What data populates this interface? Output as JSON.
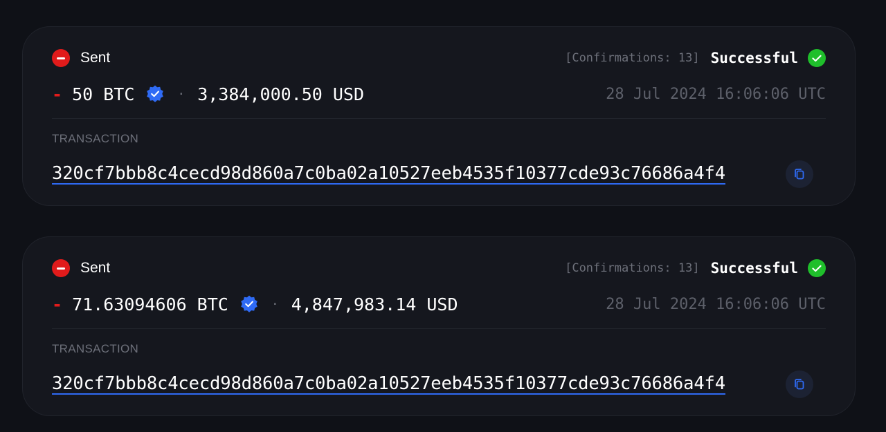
{
  "transactions": [
    {
      "direction": "Sent",
      "confirmations": "[Confirmations: 13]",
      "status": "Successful",
      "sign": "-",
      "amount": "50 BTC",
      "fiat": "3,384,000.50 USD",
      "separator": "·",
      "timestamp": "28 Jul 2024 16:06:06 UTC",
      "section_label": "TRANSACTION",
      "hash": "320cf7bbb8c4cecd98d860a7c0ba02a10527eeb4535f10377cde93c76686a4f4"
    },
    {
      "direction": "Sent",
      "confirmations": "[Confirmations: 13]",
      "status": "Successful",
      "sign": "-",
      "amount": "71.63094606 BTC",
      "fiat": "4,847,983.14 USD",
      "separator": "·",
      "timestamp": "28 Jul 2024 16:06:06 UTC",
      "section_label": "TRANSACTION",
      "hash": "320cf7bbb8c4cecd98d860a7c0ba02a10527eeb4535f10377cde93c76686a4f4"
    }
  ],
  "icons": {
    "direction": "minus-circle-icon",
    "status": "check-circle-icon",
    "verified": "verified-badge-icon",
    "copy": "copy-icon"
  },
  "colors": {
    "background": "#0f1117",
    "card": "#15171e",
    "sent_red": "#e11b1b",
    "success_green": "#1fbf2b",
    "verified_blue": "#2f6bf5",
    "link_underline": "#2f6bf5",
    "muted_text": "#6d707a"
  }
}
